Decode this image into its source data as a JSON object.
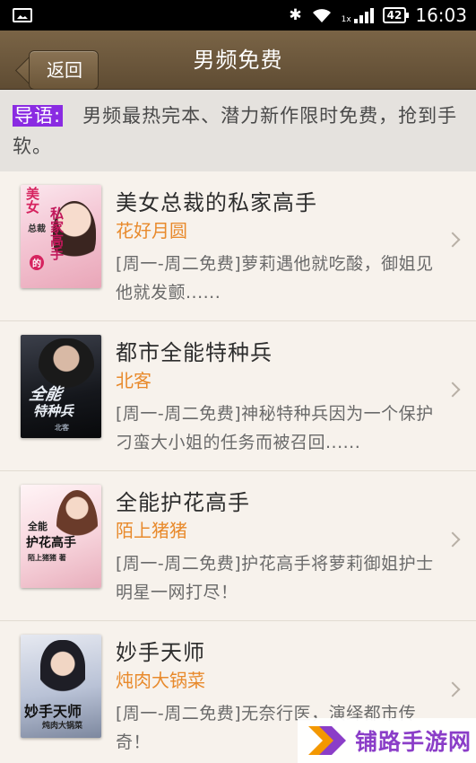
{
  "status_bar": {
    "network": "1x",
    "battery": "42",
    "time": "16:03"
  },
  "header": {
    "back_label": "返回",
    "title": "男频免费"
  },
  "intro": {
    "tag": "导语:",
    "text": "男频最热完本、潜力新作限时免费，抢到手软。"
  },
  "books": [
    {
      "title": "美女总裁的私家高手",
      "author": "花好月圆",
      "description": "[周一-周二免费]萝莉遇他就吃酸，御姐见他就发颤......",
      "cover_text": [
        "美女",
        "总裁",
        "的",
        "私家高手"
      ]
    },
    {
      "title": "都市全能特种兵",
      "author": "北客",
      "description": "[周一-周二免费]神秘特种兵因为一个保护刁蛮大小姐的任务而被召回......",
      "cover_text": [
        "全能",
        "特种兵",
        "北客"
      ]
    },
    {
      "title": "全能护花高手",
      "author": "陌上猪猪",
      "description": "[周一-周二免费]护花高手将萝莉御姐护士明星一网打尽！",
      "cover_text": [
        "全能",
        "护花高手",
        "陌上猪猪 著"
      ]
    },
    {
      "title": "妙手天师",
      "author": "炖肉大锅菜",
      "description": "[周一-周二免费]无奈行医，演绎都市传奇！",
      "cover_text": [
        "妙手天师",
        "炖肉大锅菜"
      ]
    }
  ],
  "watermark": {
    "text": "铺路手游网"
  },
  "colors": {
    "title_bar": "#6b563a",
    "author": "#e88a2c",
    "intro_tag": "#8a2be2",
    "watermark": "#8b3ec8"
  }
}
